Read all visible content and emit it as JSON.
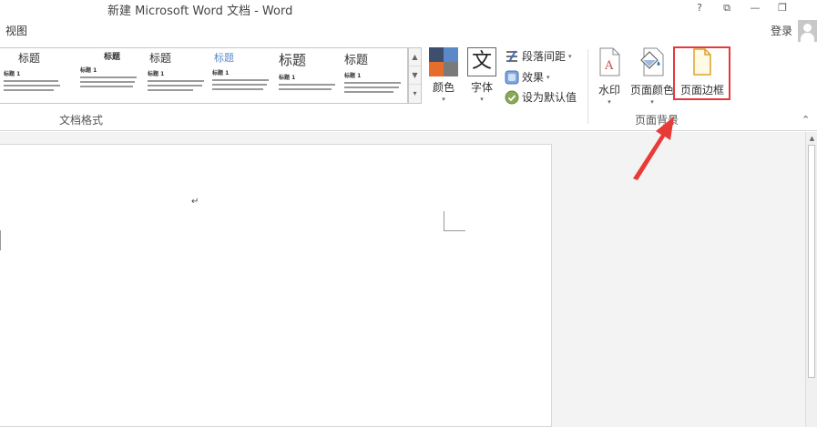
{
  "titlebar": {
    "title": "新建 Microsoft Word 文档 - Word",
    "help": "?",
    "restore_ribbon": "⧉",
    "minimize": "—",
    "maximize": "❐"
  },
  "menu": {
    "tab_view": "视图",
    "login": "登录"
  },
  "gallery": {
    "styles": [
      {
        "title": "标题",
        "heading": "标题 1"
      },
      {
        "title": "标题",
        "heading": "标题 1"
      },
      {
        "title": "标题",
        "heading": "标题 1"
      },
      {
        "title": "标题",
        "heading": "标题 1"
      },
      {
        "title": "标题",
        "heading": "标题 1"
      },
      {
        "title": "标题",
        "heading": "标题 1"
      }
    ],
    "scroll_up": "▲",
    "scroll_down": "▼",
    "more": "▾"
  },
  "groups": {
    "document_format": "文档格式",
    "page_background": "页面背景"
  },
  "buttons": {
    "colors": "颜色",
    "fonts": "字体",
    "fonts_icon_char": "文",
    "paragraph_spacing": "段落间距",
    "effects": "效果",
    "set_default": "设为默认值",
    "watermark": "水印",
    "page_color": "页面颜色",
    "page_borders": "页面边框",
    "dropdown": "▾"
  },
  "document": {
    "paragraph_mark": "↵"
  },
  "colors": {
    "highlight": "#e3393f",
    "swatch_1": "#3d4f6c",
    "swatch_2": "#5b89c8",
    "swatch_3": "#e76d2c",
    "swatch_4": "#7a7a7a"
  },
  "icons": {
    "colors": "color-theme-icon",
    "fonts": "font-theme-icon",
    "paragraph_spacing": "paragraph-spacing-icon",
    "effects": "effects-icon",
    "set_default": "checkmark-icon",
    "watermark": "watermark-icon",
    "page_color": "paint-bucket-icon",
    "page_borders": "page-border-icon",
    "annotation": "red-arrow-icon"
  }
}
